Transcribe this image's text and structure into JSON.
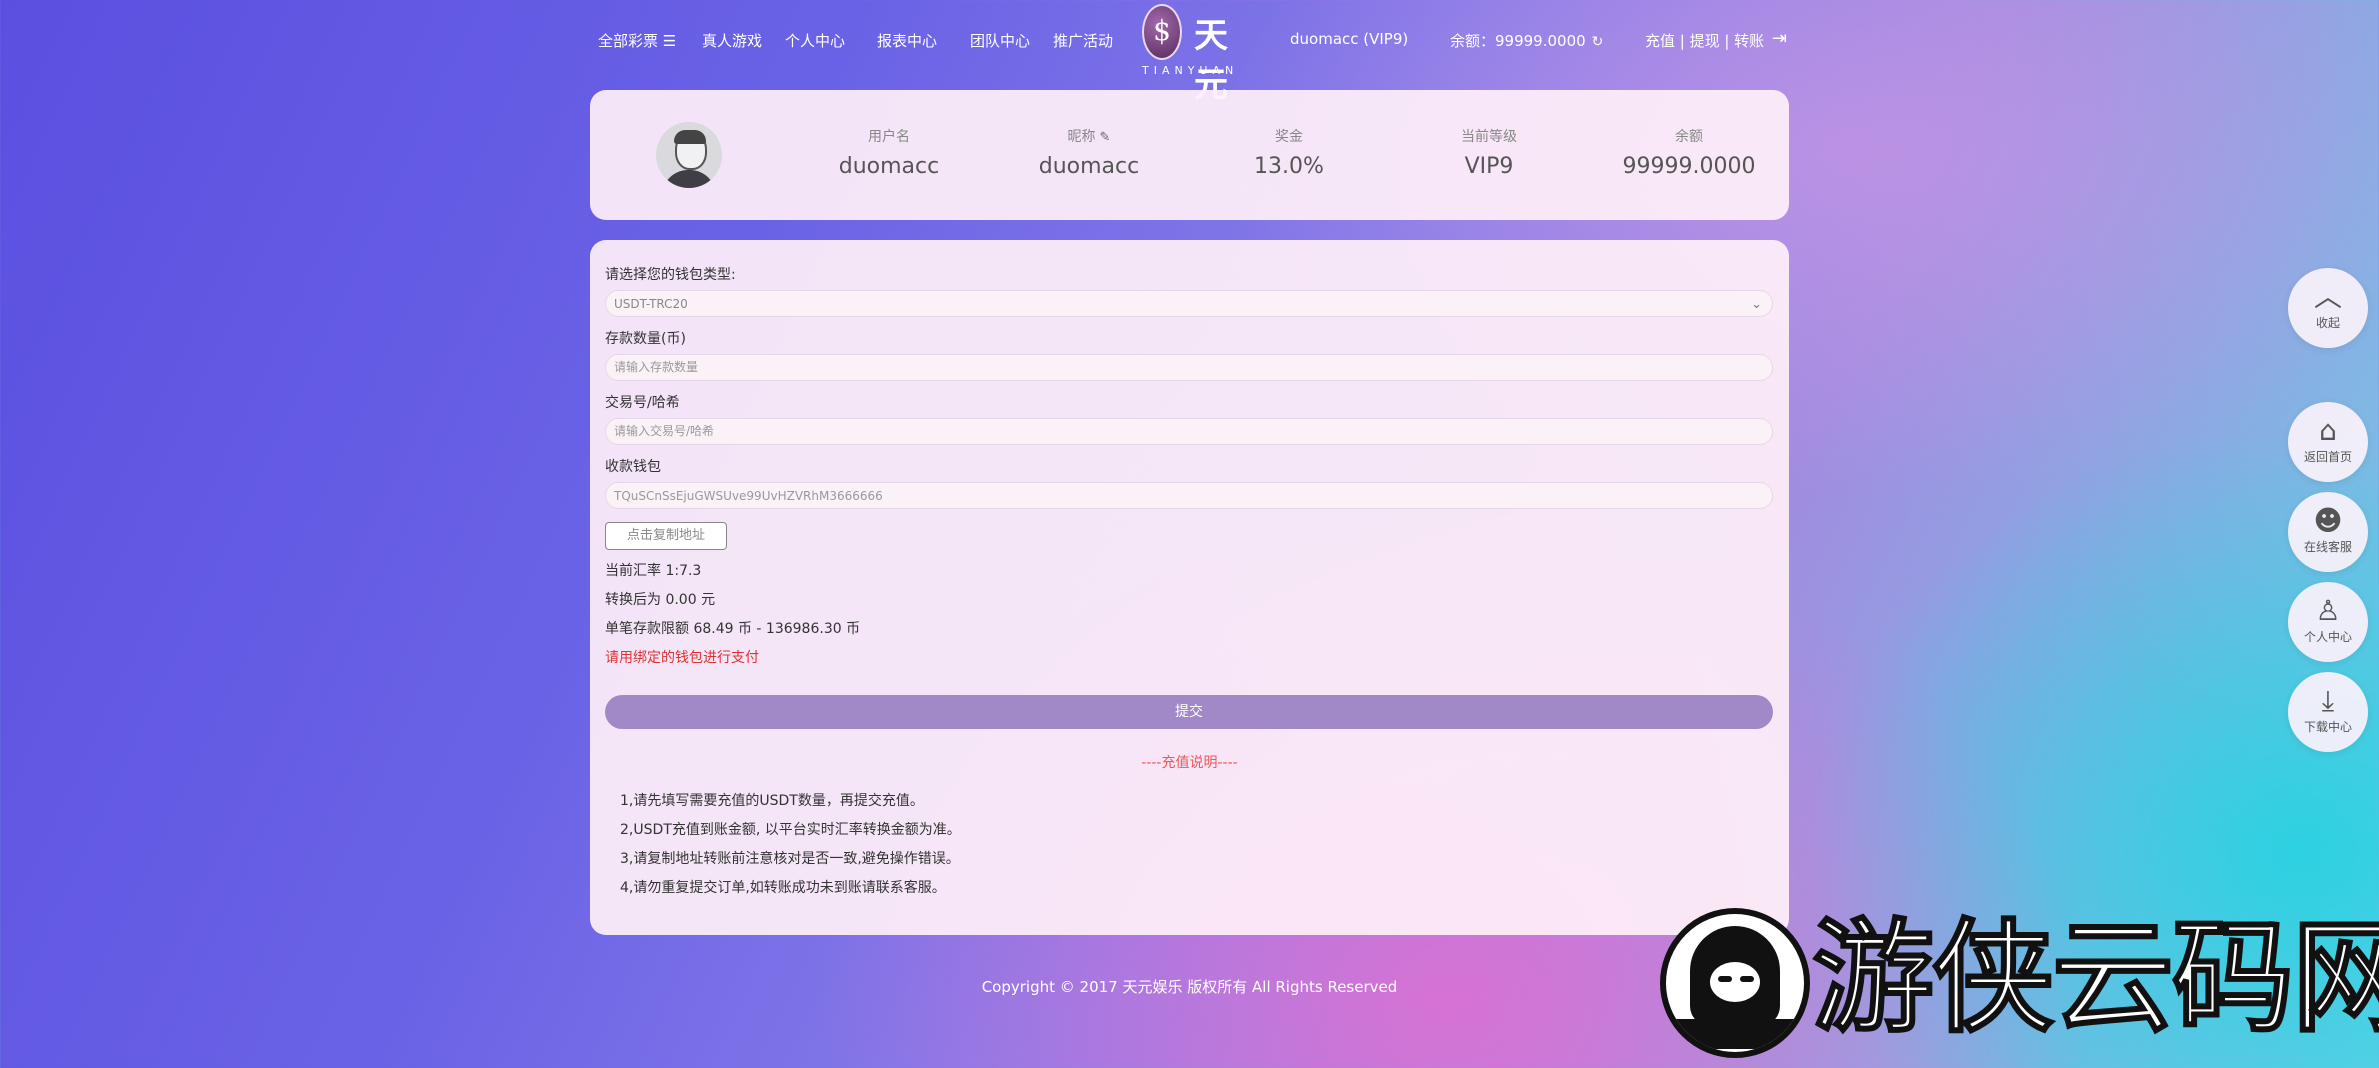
{
  "nav": {
    "items": [
      "全部彩票 ☰",
      "真人游戏",
      "个人中心",
      "报表中心",
      "团队中心",
      "推广活动"
    ],
    "logo_cn": "天元",
    "logo_en": "TIANYUAN",
    "logo_mark": "$",
    "user": "duomacc (VIP9)",
    "balance": "余额：99999.0000",
    "refresh_icon": "↻",
    "links": "充值 | 提现 | 转账",
    "logout_icon": "⇥"
  },
  "profile": {
    "username_label": "用户名",
    "username": "duomacc",
    "nickname_label": "昵称",
    "nickname": "duomacc",
    "pencil_icon": "✎",
    "bonus_label": "奖金",
    "bonus": "13.0%",
    "level_label": "当前等级",
    "level": "VIP9",
    "balance_label": "余额",
    "balance": "99999.0000"
  },
  "form": {
    "wallet_type_label": "请选择您的钱包类型:",
    "wallet_type_value": "USDT-TRC20",
    "amount_label": "存款数量(币)",
    "amount_placeholder": "请输入存款数量",
    "txid_label": "交易号/哈希",
    "txid_placeholder": "请输入交易号/哈希",
    "wallet_label": "收款钱包",
    "wallet_address": "TQuSCnSsEjuGWSUve99UvHZVRhM3666666",
    "copy_button": "点击复制地址",
    "rate": "当前汇率 1:7.3",
    "converted": "转换后为 0.00 元",
    "limit": "单笔存款限额 68.49 币 - 136986.30 币",
    "warning": "请用绑定的钱包进行支付",
    "submit": "提交",
    "notes_title": "----充值说明----",
    "notes": [
      "1,请先填写需要充值的USDT数量，再提交充值。",
      "2,USDT充值到账金额, 以平台实时汇率转换金额为准。",
      "3,请复制地址转账前注意核对是否一致,避免操作错误。",
      "4,请勿重复提交订单,如转账成功未到账请联系客服。"
    ]
  },
  "footer": {
    "copyright": "Copyright © 2017 天元娱乐 版权所有 All Rights Reserved"
  },
  "side": [
    {
      "icon": "︿",
      "label": "收起"
    },
    {
      "icon": "⌂",
      "label": "返回首页"
    },
    {
      "icon": "☻",
      "label": "在线客服"
    },
    {
      "icon": "♙",
      "label": "个人中心"
    },
    {
      "icon": "⤓",
      "label": "下载中心"
    }
  ],
  "watermark": {
    "text": "游侠云码网"
  }
}
